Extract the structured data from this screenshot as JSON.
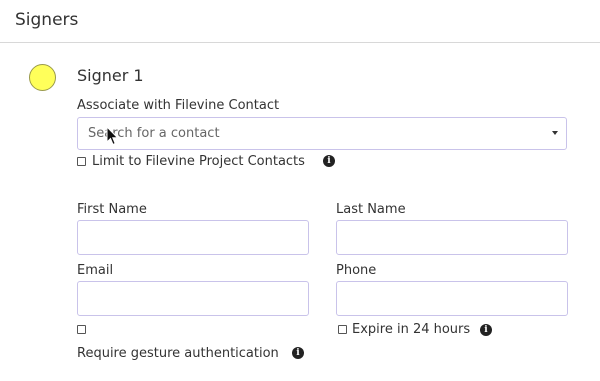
{
  "section": {
    "title": "Signers"
  },
  "signer": {
    "title": "Signer 1",
    "avatar_color": "#ffff5a",
    "associate_label": "Associate with Filevine Contact",
    "contact_search_placeholder": "Search for a contact",
    "limit_label": "Limit to Filevine Project Contacts",
    "limit_checked": false,
    "first_name_label": "First Name",
    "first_name_value": "",
    "last_name_label": "Last Name",
    "last_name_value": "",
    "email_label": "Email",
    "email_value": "",
    "phone_label": "Phone",
    "phone_value": "",
    "gesture_checked": false,
    "gesture_label": "Require gesture authentication",
    "expire_checked": false,
    "expire_label": "Expire in 24 hours"
  },
  "icons": {
    "info": "info-circle",
    "dropdown": "caret-down",
    "cursor": "mouse-pointer"
  },
  "colors": {
    "input_border": "#c9c3ea",
    "avatar": "#ffff5a"
  }
}
